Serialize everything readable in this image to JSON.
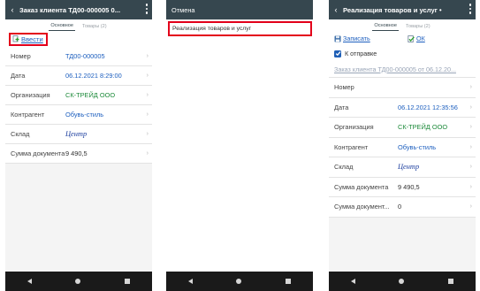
{
  "screen1": {
    "title": "Заказ клиента ТД00-000005 0...",
    "tabs": [
      {
        "label": "Основное"
      },
      {
        "label": "Товары (2)"
      }
    ],
    "introduce_label": "Ввести",
    "rows": [
      {
        "label": "Номер",
        "value": "ТД00-000005"
      },
      {
        "label": "Дата",
        "value": "06.12.2021 8:29:00"
      },
      {
        "label": "Организация",
        "value": "СК-ТРЕЙД ООО"
      },
      {
        "label": "Контрагент",
        "value": "Обувь-стиль"
      },
      {
        "label": "Склад",
        "value": "Центр"
      },
      {
        "label": "Сумма документа",
        "value": "9 490,5"
      }
    ]
  },
  "screen2": {
    "title": "Отмена",
    "item_label": "Реализация товаров и услуг"
  },
  "screen3": {
    "title": "Реализация товаров и услуг",
    "tabs": [
      {
        "label": "Основное"
      },
      {
        "label": "Товары (2)"
      }
    ],
    "save_label": "Записать",
    "ok_label": "ОК",
    "checkbox_label": "К отправке",
    "base_link": "Заказ клиента ТД00-000005 от 06.12.20...",
    "rows": [
      {
        "label": "Номер",
        "value": ""
      },
      {
        "label": "Дата",
        "value": "06.12.2021 12:35:56"
      },
      {
        "label": "Организация",
        "value": "СК-ТРЕЙД ООО"
      },
      {
        "label": "Контрагент",
        "value": "Обувь-стиль"
      },
      {
        "label": "Склад",
        "value": "Центр"
      },
      {
        "label": "Сумма документа",
        "value": "9 490,5"
      },
      {
        "label": "Сумма документ...",
        "value": "0"
      }
    ]
  },
  "icons": {
    "back": "chevron-left-icon",
    "menu": "kebab-menu-icon",
    "chevron": "chevron-right-icon",
    "introduce": "document-add-icon",
    "save": "floppy-disk-icon",
    "ok": "checkmark-document-icon",
    "nav_back": "triangle-back-icon",
    "nav_home": "circle-home-icon",
    "nav_recent": "square-recent-icon"
  },
  "colors": {
    "appbar": "#36474f",
    "link": "#1d5fbf",
    "org_green": "#1d8a3a",
    "highlight_red": "#e3001b",
    "navbar": "#1a1a1a"
  }
}
